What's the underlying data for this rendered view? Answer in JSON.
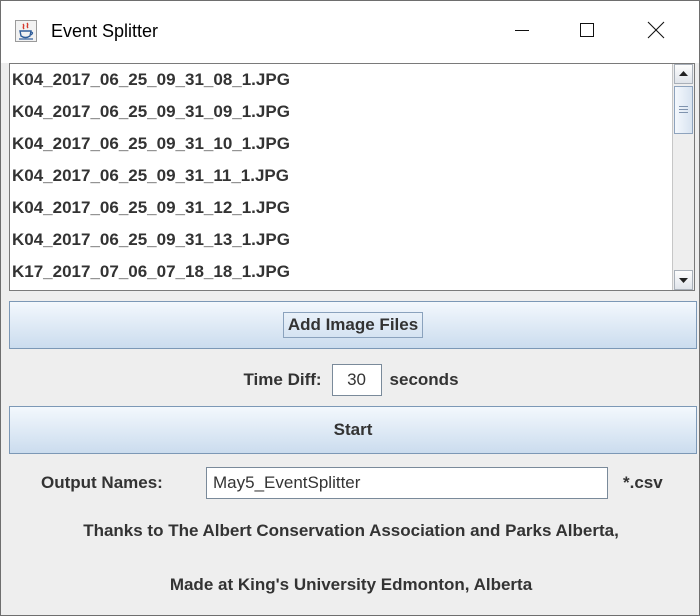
{
  "window": {
    "title": "Event Splitter",
    "icon": "java-cup-icon"
  },
  "controls": {
    "minimize": "minimize-icon",
    "maximize": "maximize-icon",
    "close": "close-icon"
  },
  "file_list": {
    "items": [
      "K04_2017_06_25_09_31_08_1.JPG",
      "K04_2017_06_25_09_31_09_1.JPG",
      "K04_2017_06_25_09_31_10_1.JPG",
      "K04_2017_06_25_09_31_11_1.JPG",
      "K04_2017_06_25_09_31_12_1.JPG",
      "K04_2017_06_25_09_31_13_1.JPG",
      "K17_2017_07_06_07_18_18_1.JPG"
    ]
  },
  "buttons": {
    "add_images": "Add Image Files",
    "start": "Start"
  },
  "time_diff": {
    "label": "Time Diff:",
    "value": "30",
    "unit": "seconds"
  },
  "output": {
    "label": "Output Names:",
    "value": "May5_EventSplitter",
    "extension": "*.csv"
  },
  "credits": {
    "line1": "Thanks to The Albert Conservation Association and Parks Alberta,",
    "line2": "Made at King's University Edmonton, Alberta"
  },
  "colors": {
    "button_top": "#f3f8fd",
    "button_bottom": "#cbdcee",
    "panel_bg": "#eeeeee",
    "text": "#333333"
  }
}
